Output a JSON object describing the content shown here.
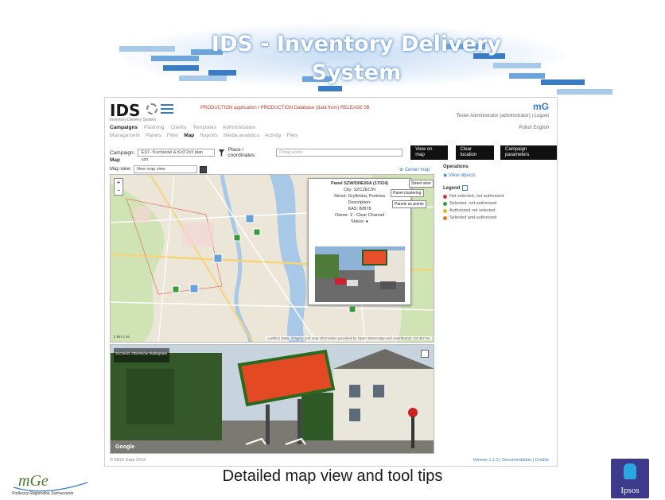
{
  "slide": {
    "title_line1": "IDS - Inventory Delivery",
    "title_line2": "System",
    "caption": "Detailed map view and tool tips",
    "mge_logo_text": "mGe",
    "mge_sub": "Podkrovy Regionalne Zaznaczenie",
    "ipsos_label": "Ipsos"
  },
  "app": {
    "logo": "IDS",
    "logo_sub": "Inventory Delivery System",
    "production_note": "PRODUCTION application / PRODUCTION Database (data from) RELEASE 0B",
    "brand_mark": "mG",
    "user_info": "Tester Administrator (administrator) | Logout",
    "language": "Polish  English",
    "nav_primary": [
      "Campaigns",
      "Planning",
      "Clients",
      "Templates",
      "Administration"
    ],
    "nav_secondary": [
      "Management",
      "Panels",
      "Filter",
      "Map",
      "Reports",
      "Media analytics",
      "Activity",
      "Files"
    ],
    "campaign_label": "Campaign:",
    "campaign_value": "E10 - Kucharski & Ko3 2x3 plan uzn.",
    "place_label": "Place / coordinates:",
    "place_placeholder": "Podaj adres",
    "btn_view_on_map": "View on map",
    "btn_clear_location": "Clear location",
    "btn_campaign_params": "Campaign parameters",
    "map_section_label": "Map",
    "map_view_label": "Map view:",
    "map_view_value": "New map view",
    "center_map": "⊕ Center map",
    "operations_title": "Operations",
    "view_objects": "◉ View objects",
    "legend_title": "Legend",
    "legend": [
      {
        "label": "Not selected, not authorized",
        "color": "#d23a3a"
      },
      {
        "label": "Selected, not authorized",
        "color": "#3a9a3a"
      },
      {
        "label": "Authorized not selected",
        "color": "#e6b81e"
      },
      {
        "label": "Selected and authorized",
        "color": "#e07a1e"
      }
    ],
    "popup": {
      "title": "Panel SZW/DNE00A (17024)",
      "lines": [
        "City: SZCZECIN",
        "Street: Gryfińska, Portowa",
        "Description:",
        "KAS: B/B78",
        "Owner: 2 - Clear Channel",
        "Status: ●"
      ],
      "btn_street_view": "Street view",
      "btn_panel_clustering": "Panel clustering",
      "btn_panels_as_points": "Panels as points"
    },
    "map_attribution": "Leaflet | Data, imagery and map information provided by Open Street Map and contributors, CC-BY-SA",
    "map_scale": "2 km\n1 mi",
    "sv_address": "Szczecin, Obrońców Stalingradu",
    "sv_google": "Google",
    "footer_left": "© MGE Data 2014",
    "footer_right": "Version 1.1.0 | Documentation | Credits"
  }
}
